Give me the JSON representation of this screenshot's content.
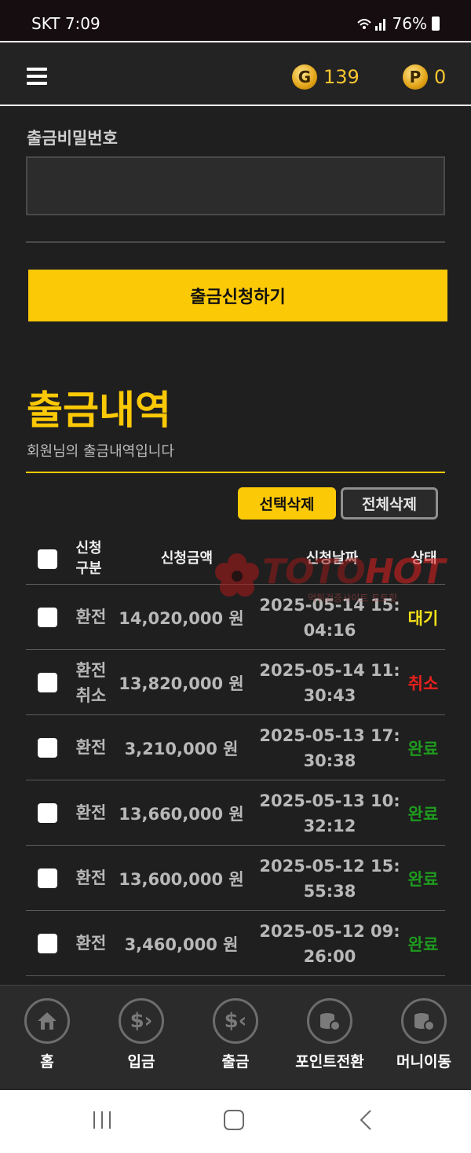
{
  "status_bar": {
    "carrier_time": "SKT 7:09",
    "battery": "76%"
  },
  "header": {
    "g_coin": {
      "letter": "G",
      "value": "139"
    },
    "p_coin": {
      "letter": "P",
      "value": "0"
    }
  },
  "form": {
    "password_label": "출금비밀번호",
    "password_value": "",
    "submit_label": "출금신청하기"
  },
  "history": {
    "title": "출금내역",
    "subtitle": "회원님의 출금내역입니다",
    "delete_selected": "선택삭제",
    "delete_all": "전체삭제",
    "columns": {
      "type_line1": "신청",
      "type_line2": "구분",
      "amount": "신청금액",
      "date": "신청날짜",
      "status": "상태"
    },
    "rows": [
      {
        "type1": "환전",
        "type2": "",
        "amount": "14,020,000 원",
        "date": "2025-05-14 15:04:16",
        "status": "대기",
        "status_color": "#f5e11a"
      },
      {
        "type1": "환전",
        "type2": "취소",
        "amount": "13,820,000 원",
        "date": "2025-05-14 11:30:43",
        "status": "취소",
        "status_color": "#e8201c"
      },
      {
        "type1": "환전",
        "type2": "",
        "amount": "3,210,000 원",
        "date": "2025-05-13 17:30:38",
        "status": "완료",
        "status_color": "#1f9a1f"
      },
      {
        "type1": "환전",
        "type2": "",
        "amount": "13,660,000 원",
        "date": "2025-05-13 10:32:12",
        "status": "완료",
        "status_color": "#1f9a1f"
      },
      {
        "type1": "환전",
        "type2": "",
        "amount": "13,600,000 원",
        "date": "2025-05-12 15:55:38",
        "status": "완료",
        "status_color": "#1f9a1f"
      },
      {
        "type1": "환전",
        "type2": "",
        "amount": "3,460,000 원",
        "date": "2025-05-12 09:26:00",
        "status": "완료",
        "status_color": "#1f9a1f"
      }
    ]
  },
  "watermark": {
    "logo_a": "TOTO",
    "logo_b": "HOT",
    "tagline": "먹튀검증사이트 토토핫"
  },
  "bottom_nav": [
    {
      "label": "홈",
      "icon": "home-icon"
    },
    {
      "label": "입금",
      "icon": "deposit-icon"
    },
    {
      "label": "출금",
      "icon": "withdraw-icon"
    },
    {
      "label": "포인트전환",
      "icon": "coins-icon"
    },
    {
      "label": "머니이동",
      "icon": "coins-icon"
    }
  ],
  "colors": {
    "accent": "#fcc906",
    "background": "#1f1f1f"
  }
}
